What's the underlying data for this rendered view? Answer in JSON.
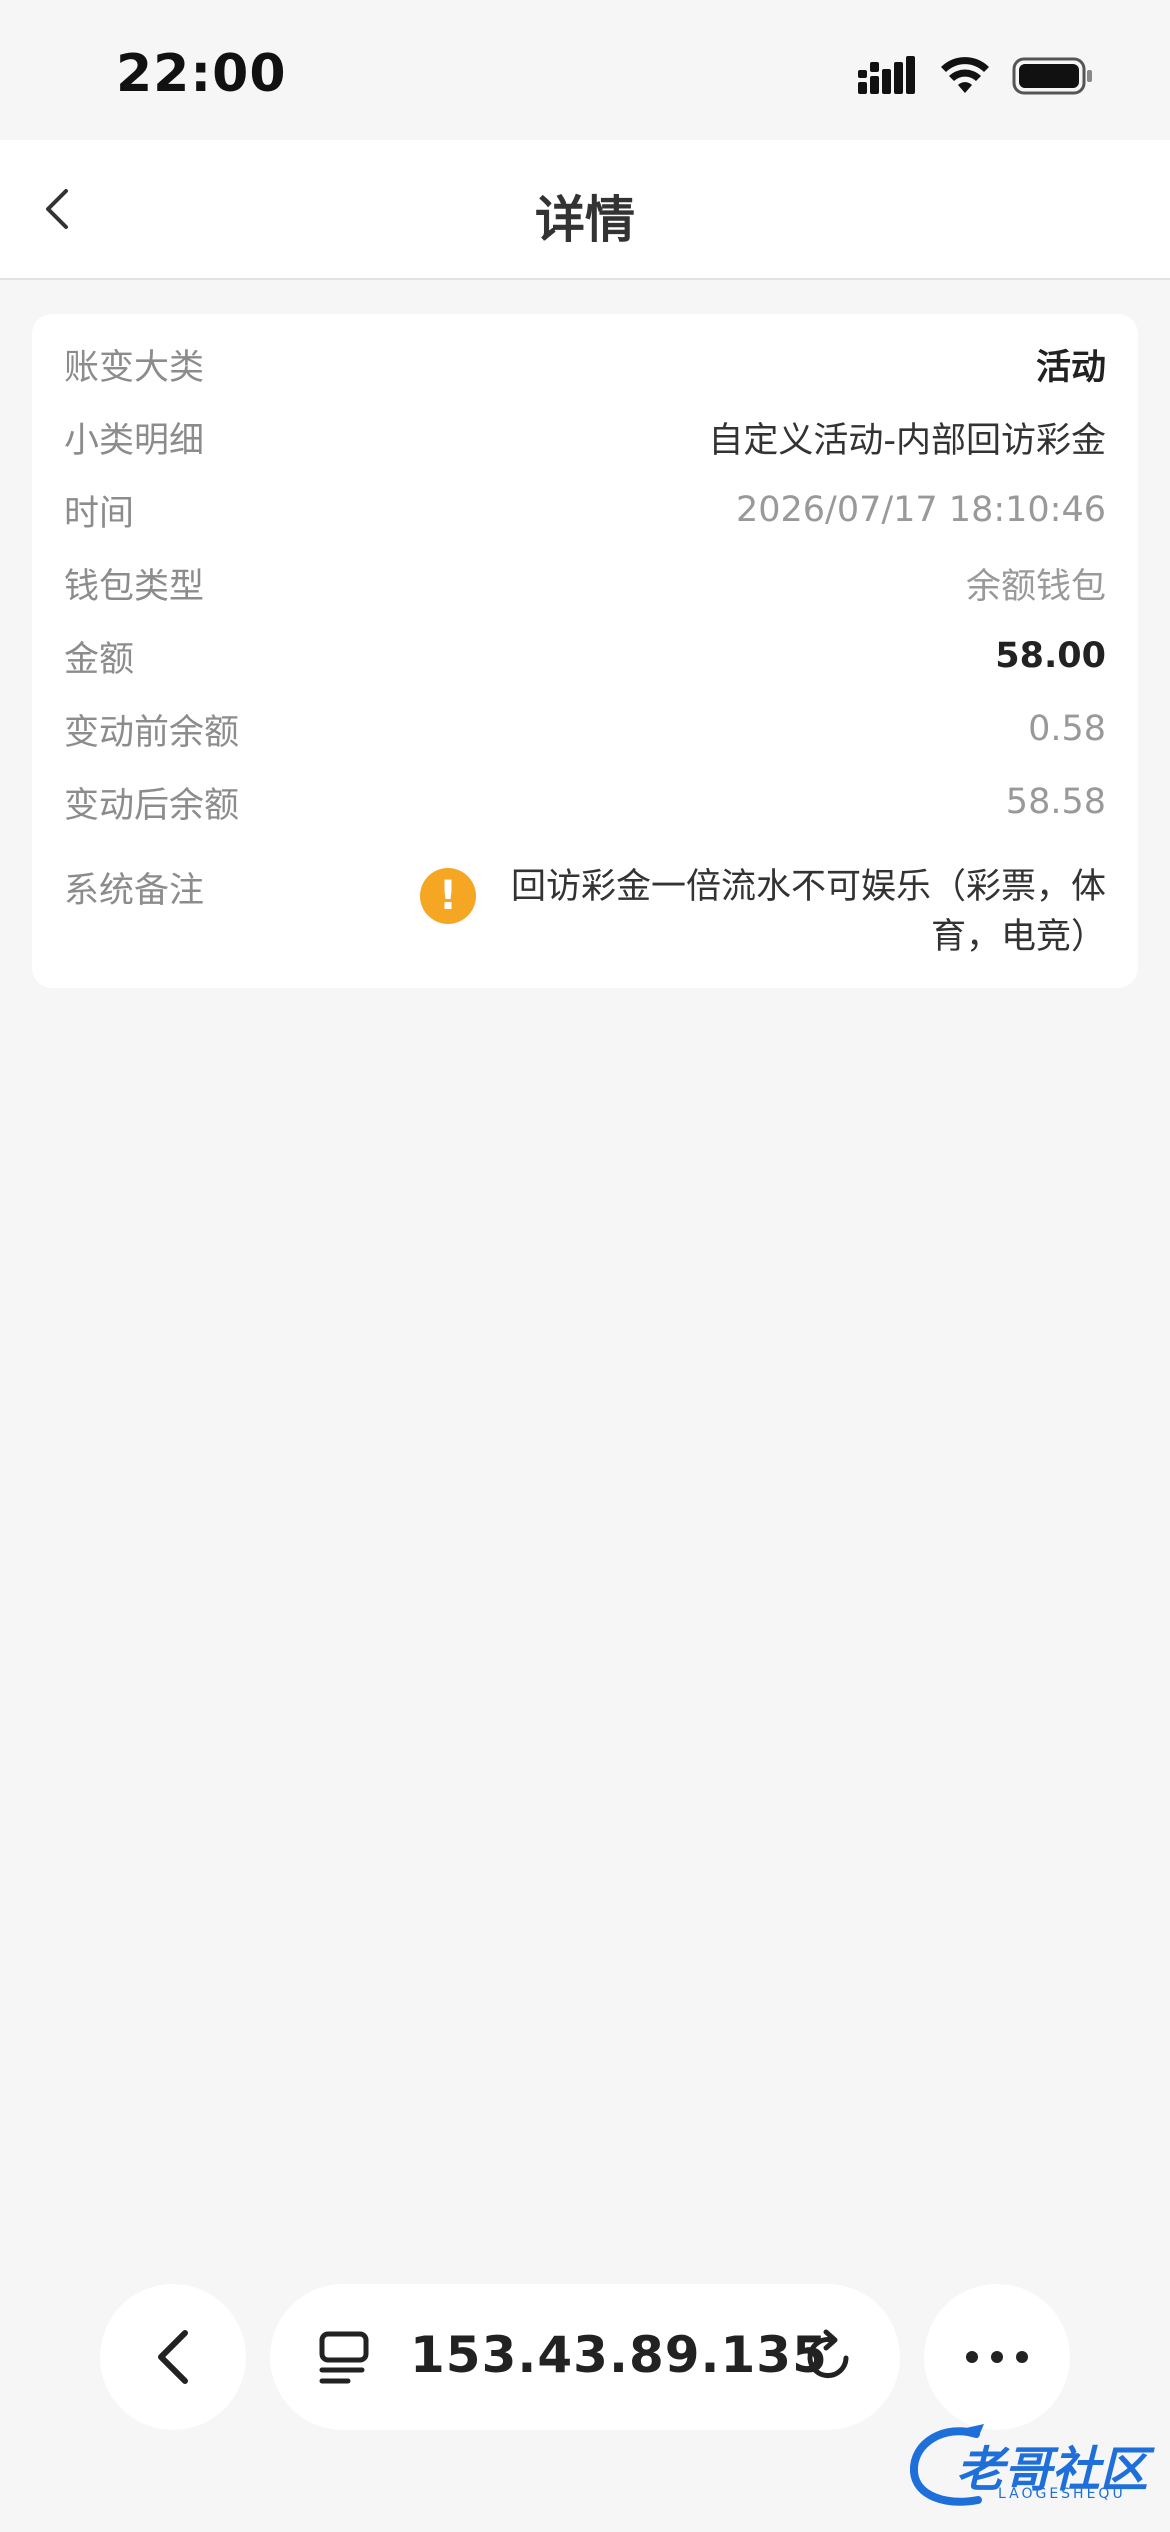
{
  "status_bar": {
    "time": "22:00"
  },
  "nav": {
    "title": "详情"
  },
  "details": {
    "rows": [
      {
        "label": "账变大类",
        "value": "活动"
      },
      {
        "label": "小类明细",
        "value": "自定义活动-内部回访彩金"
      },
      {
        "label": "时间",
        "value": "2026/07/17 18:10:46"
      },
      {
        "label": "钱包类型",
        "value": "余额钱包"
      },
      {
        "label": "金额",
        "value": "58.00"
      },
      {
        "label": "变动前余额",
        "value": "0.58"
      },
      {
        "label": "变动后余额",
        "value": "58.58"
      }
    ],
    "remark": {
      "label": "系统备注",
      "icon": "!",
      "line1": "回访彩金一倍流水不可娱乐（彩票，体",
      "line2": "育，电竞）"
    }
  },
  "browser": {
    "address": "153.43.89.135"
  },
  "watermark": {
    "text": "老哥社区",
    "sub": "LAOGESHEQU"
  },
  "colors": {
    "warning": "#f5a623",
    "background": "#f6f6f7"
  }
}
